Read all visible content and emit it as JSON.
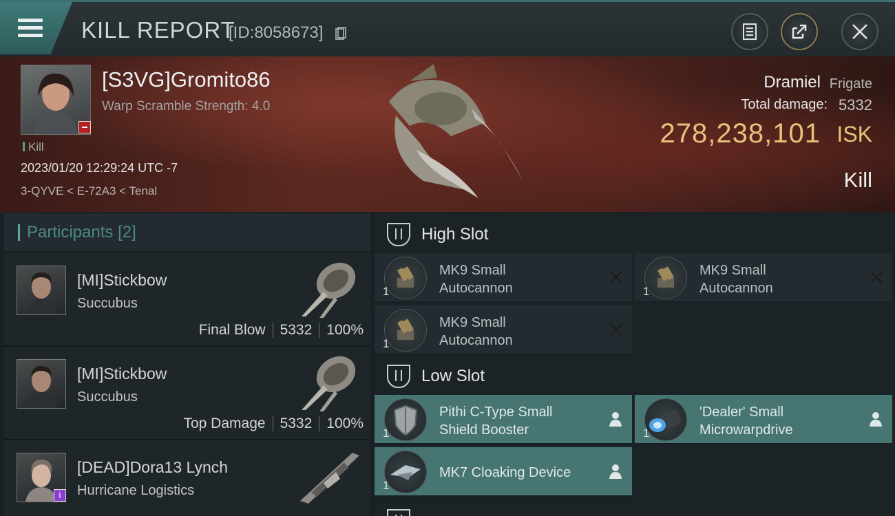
{
  "header": {
    "title": "KILL REPORT",
    "report_id": "[ID:8058673]"
  },
  "victim": {
    "name": "[S3VG]Gromito86",
    "warp_scramble": "Warp Scramble Strength: 4.0",
    "kill_tag": "Kill",
    "timestamp": "2023/01/20 12:29:24 UTC -7",
    "location": "3-QYVE < E-72A3 < Tenal",
    "ship_name": "Dramiel",
    "ship_class": "Frigate",
    "total_damage_label": "Total damage:",
    "total_damage_value": "5332",
    "isk_value": "278,238,101",
    "isk_unit": "ISK",
    "result": "Kill"
  },
  "participants": {
    "label": "Participants",
    "count": "[2]",
    "rows": [
      {
        "name": "[MI]Stickbow",
        "ship": "Succubus",
        "role": "Final Blow",
        "damage": "5332",
        "percent": "100%"
      },
      {
        "name": "[MI]Stickbow",
        "ship": "Succubus",
        "role": "Top Damage",
        "damage": "5332",
        "percent": "100%"
      },
      {
        "name": "[DEAD]Dora13 Lynch",
        "ship": "Hurricane Logistics",
        "badge": "i"
      }
    ]
  },
  "fitting": {
    "high_slot": {
      "label": "High Slot",
      "modules": [
        {
          "qty": "1",
          "line1": "MK9 Small",
          "line2": "Autocannon"
        },
        {
          "qty": "1",
          "line1": "MK9 Small",
          "line2": "Autocannon"
        },
        {
          "qty": "1",
          "line1": "MK9 Small",
          "line2": "Autocannon"
        }
      ]
    },
    "low_slot": {
      "label": "Low Slot",
      "modules": [
        {
          "qty": "1",
          "line1": "Pithi C-Type Small",
          "line2": "Shield Booster"
        },
        {
          "qty": "1",
          "line1": "'Dealer' Small",
          "line2": "Microwarpdrive"
        },
        {
          "qty": "1",
          "line1": "MK7 Cloaking Device",
          "line2": ""
        }
      ]
    }
  },
  "colors": {
    "accent_teal": "#467572",
    "isk_gold": "#e8c27c",
    "menu_tab": "#3f7a78"
  },
  "icons": {
    "menu": "hamburger-menu-icon",
    "copy": "copy-icon",
    "document": "document-icon",
    "share": "share-icon",
    "close": "close-icon",
    "slot": "slot-icon",
    "remove": "x-icon",
    "person": "person-icon"
  }
}
